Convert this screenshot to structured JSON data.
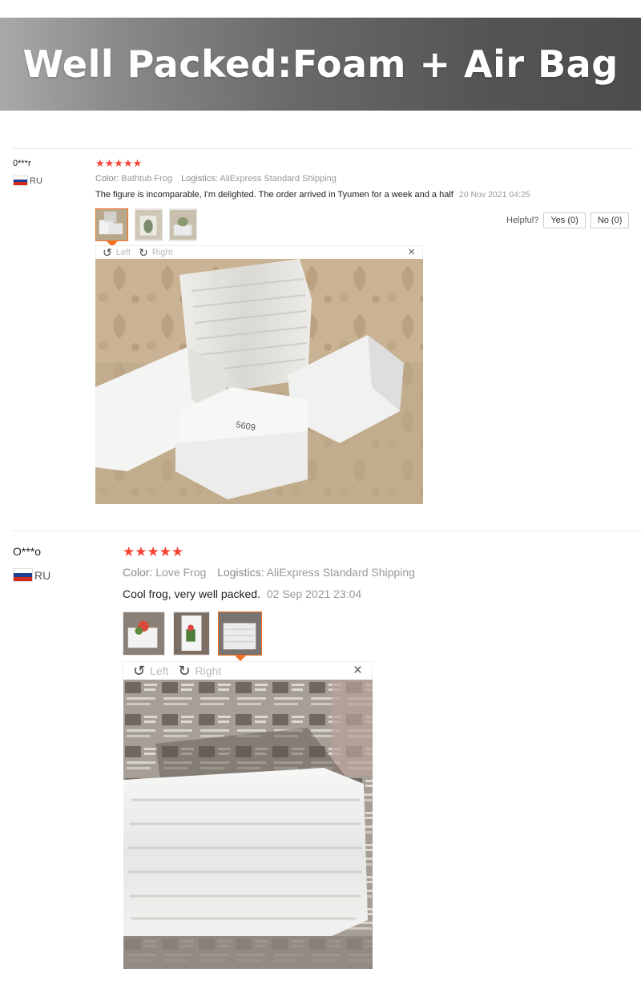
{
  "banner": {
    "title": "Well Packed:Foam + Air Bag"
  },
  "helpful": {
    "label": "Helpful?",
    "yes": "Yes (0)",
    "no": "No (0)"
  },
  "reviews": [
    {
      "user": "0***r",
      "country": "RU",
      "stars": "★★★★★",
      "color_label": "Color:",
      "color_value": "Bathtub Frog",
      "logistics_label": "Logistics:",
      "logistics_value": "AliExpress Standard Shipping",
      "text": "The figure is incomparable, I'm delighted. The order arrived in Tyumen for a week and a half",
      "date": "20 Nov 2021 04:25",
      "rotate_left": "Left",
      "rotate_right": "Right",
      "close": "×"
    },
    {
      "user": "O***o",
      "country": "RU",
      "stars": "★★★★★",
      "color_label": "Color:",
      "color_value": "Love Frog",
      "logistics_label": "Logistics:",
      "logistics_value": "AliExpress Standard Shipping",
      "text": "Cool frog, very well packed.",
      "date": "02 Sep 2021 23:04",
      "rotate_left": "Left",
      "rotate_right": "Right",
      "close": "×"
    }
  ],
  "icons": {
    "rotate_left": "↺",
    "rotate_right": "↻",
    "close": "close-icon"
  },
  "colors": {
    "star": "#f44336",
    "accent": "#f57224"
  }
}
